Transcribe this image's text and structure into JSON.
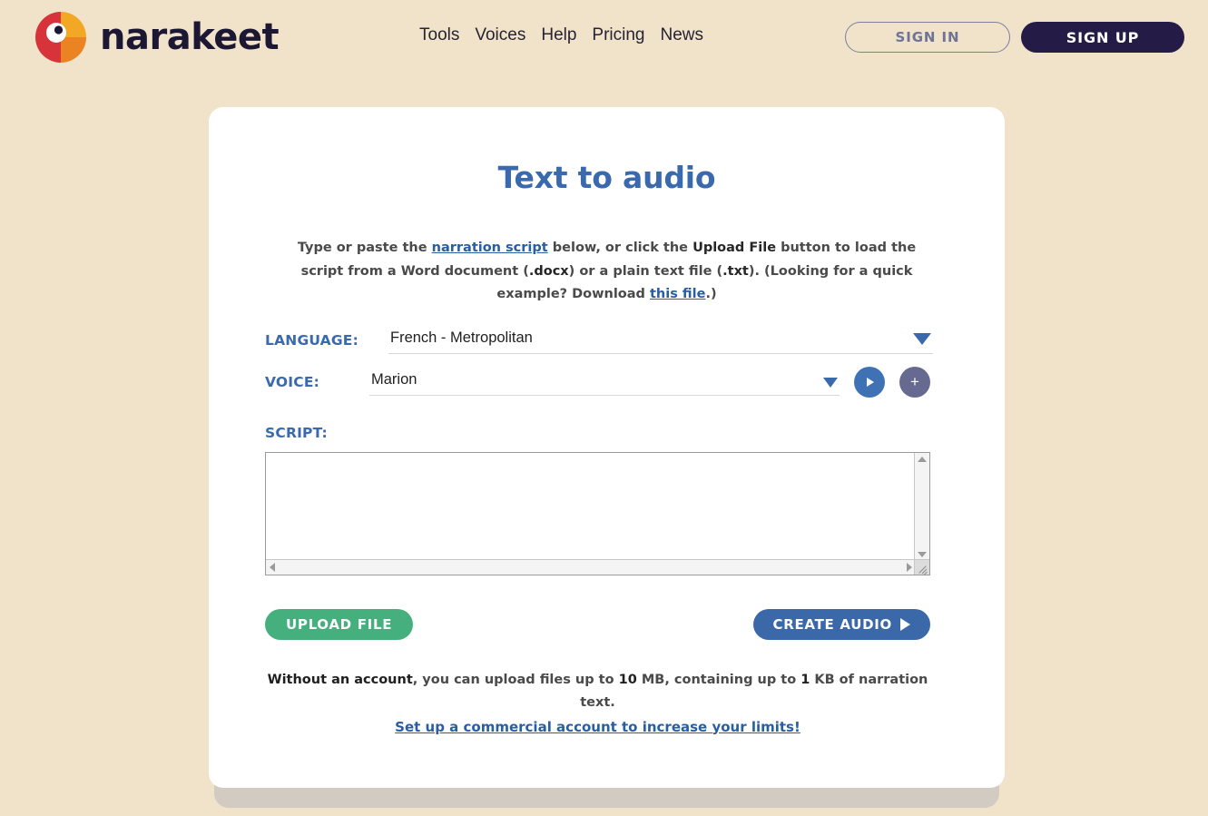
{
  "theme": {
    "page_bg": "#f0e3ca",
    "card_bg": "#ffffff",
    "accent_blue": "#3a6aad",
    "green": "#45b07e",
    "navy": "#241c47"
  },
  "header": {
    "brand_name": "narakeet",
    "logo_colors": {
      "red": "#d7333a",
      "yellow": "#f2a725",
      "orange": "#ec8322",
      "eye": "#1c1733"
    },
    "nav": [
      {
        "label": "Tools"
      },
      {
        "label": "Voices"
      },
      {
        "label": "Help"
      },
      {
        "label": "Pricing"
      },
      {
        "label": "News"
      }
    ],
    "sign_in_label": "SIGN IN",
    "sign_up_label": "SIGN UP"
  },
  "main": {
    "title": "Text to audio",
    "intro": {
      "p1a": "Type or paste the ",
      "link1": "narration script",
      "p1b": " below, or click the ",
      "bold1": "Upload File",
      "p1c": " button to load the script from a Word document (",
      "bold2": ".docx",
      "p1d": ") or a plain text file (",
      "bold3": ".txt",
      "p1e": "). (Looking for a quick example? Download ",
      "link2": "this file",
      "p1f": ".)"
    },
    "language": {
      "label": "LANGUAGE:",
      "value": "French - Metropolitan",
      "caret_icon": "chevron-down-icon"
    },
    "voice": {
      "label": "VOICE:",
      "value": "Marion",
      "caret_icon": "chevron-down-icon",
      "play_icon": "play-icon",
      "add_icon": "plus-icon"
    },
    "script": {
      "label": "SCRIPT:",
      "value": "",
      "placeholder": ""
    },
    "actions": {
      "upload_label": "UPLOAD FILE",
      "create_label": "CREATE AUDIO",
      "create_icon": "play-icon"
    },
    "limits": {
      "bold_lead": "Without an account",
      "text_a": ", you can upload files up to ",
      "size": "10",
      "text_b": " MB, containing up to ",
      "chars": "1",
      "text_c": " KB of narration text.",
      "link": "Set up a commercial account to increase your limits!"
    }
  }
}
